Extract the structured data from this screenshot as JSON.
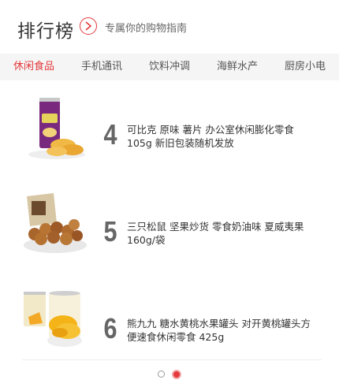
{
  "header": {
    "title": "排行榜",
    "subtitle": "专属你的购物指南"
  },
  "tabs": [
    {
      "label": "休闲食品",
      "active": true
    },
    {
      "label": "手机通讯",
      "active": false
    },
    {
      "label": "饮料冲调",
      "active": false
    },
    {
      "label": "海鲜水产",
      "active": false
    },
    {
      "label": "厨房小电",
      "active": false
    }
  ],
  "items": [
    {
      "rank": "4",
      "name": "可比克 原味 薯片 办公室休闲膨化零食105g 新旧包装随机发放",
      "image_icon": "chips-can-icon"
    },
    {
      "rank": "5",
      "name": "三只松鼠 坚果炒货 零食奶油味 夏威夷果160g/袋",
      "image_icon": "macadamia-nut-icon"
    },
    {
      "rank": "6",
      "name": "熊九九 糖水黄桃水果罐头 对开黄桃罐头方便速食休闲零食 425g",
      "image_icon": "peach-can-icon"
    }
  ],
  "pagination": {
    "current": 2,
    "total": 2
  },
  "colors": {
    "accent": "#e4393c",
    "tab_bg": "#f5f5f5"
  }
}
